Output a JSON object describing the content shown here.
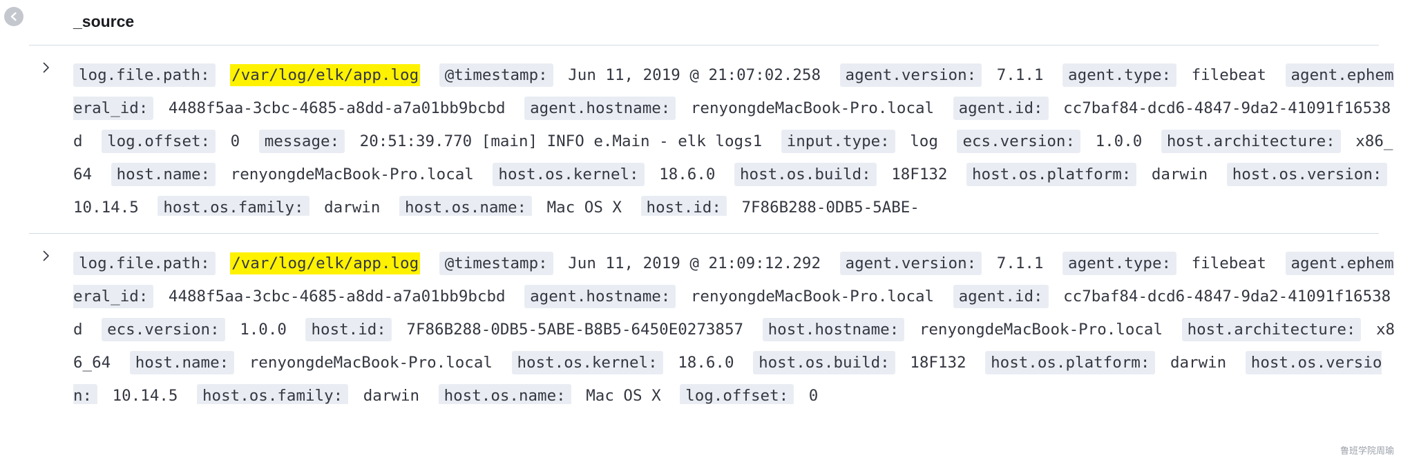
{
  "header": {
    "title": "_source"
  },
  "icons": {
    "back": "chevron-left-circle-icon",
    "expand": "chevron-right-icon"
  },
  "rows": [
    {
      "fields": [
        {
          "key": "log.file.path:",
          "value": "/var/log/elk/app.log",
          "highlight": true
        },
        {
          "key": "@timestamp:",
          "value": "Jun 11, 2019 @ 21:07:02.258"
        },
        {
          "key": "agent.version:",
          "value": "7.1.1"
        },
        {
          "key": "agent.type:",
          "value": "filebeat"
        },
        {
          "key": "agent.ephemeral_id:",
          "value": "4488f5aa-3cbc-4685-a8dd-a7a01bb9bcbd"
        },
        {
          "key": "agent.hostname:",
          "value": "renyongdeMacBook-Pro.local"
        },
        {
          "key": "agent.id:",
          "value": "cc7baf84-dcd6-4847-9da2-41091f16538d"
        },
        {
          "key": "log.offset:",
          "value": "0"
        },
        {
          "key": "message:",
          "value": "20:51:39.770 [main] INFO e.Main - elk logs1"
        },
        {
          "key": "input.type:",
          "value": "log"
        },
        {
          "key": "ecs.version:",
          "value": "1.0.0"
        },
        {
          "key": "host.architecture:",
          "value": "x86_64"
        },
        {
          "key": "host.name:",
          "value": "renyongdeMacBook-Pro.local"
        },
        {
          "key": "host.os.kernel:",
          "value": "18.6.0"
        },
        {
          "key": "host.os.build:",
          "value": "18F132"
        },
        {
          "key": "host.os.platform:",
          "value": "darwin"
        },
        {
          "key": "host.os.version:",
          "value": "10.14.5"
        },
        {
          "key": "host.os.family:",
          "value": "darwin"
        },
        {
          "key": "host.os.name:",
          "value": "Mac OS X"
        },
        {
          "key": "host.id:",
          "value": "7F86B288-0DB5-5ABE-"
        }
      ]
    },
    {
      "fields": [
        {
          "key": "log.file.path:",
          "value": "/var/log/elk/app.log",
          "highlight": true
        },
        {
          "key": "@timestamp:",
          "value": "Jun 11, 2019 @ 21:09:12.292"
        },
        {
          "key": "agent.version:",
          "value": "7.1.1"
        },
        {
          "key": "agent.type:",
          "value": "filebeat"
        },
        {
          "key": "agent.ephemeral_id:",
          "value": "4488f5aa-3cbc-4685-a8dd-a7a01bb9bcbd"
        },
        {
          "key": "agent.hostname:",
          "value": "renyongdeMacBook-Pro.local"
        },
        {
          "key": "agent.id:",
          "value": "cc7baf84-dcd6-4847-9da2-41091f16538d"
        },
        {
          "key": "ecs.version:",
          "value": "1.0.0"
        },
        {
          "key": "host.id:",
          "value": "7F86B288-0DB5-5ABE-B8B5-6450E0273857"
        },
        {
          "key": "host.hostname:",
          "value": "renyongdeMacBook-Pro.local"
        },
        {
          "key": "host.architecture:",
          "value": "x86_64"
        },
        {
          "key": "host.name:",
          "value": "renyongdeMacBook-Pro.local"
        },
        {
          "key": "host.os.kernel:",
          "value": "18.6.0"
        },
        {
          "key": "host.os.build:",
          "value": "18F132"
        },
        {
          "key": "host.os.platform:",
          "value": "darwin"
        },
        {
          "key": "host.os.version:",
          "value": "10.14.5"
        },
        {
          "key": "host.os.family:",
          "value": "darwin"
        },
        {
          "key": "host.os.name:",
          "value": "Mac OS X"
        },
        {
          "key": "log.offset:",
          "value": "0"
        }
      ]
    }
  ],
  "colors": {
    "key_bg": "#e9edf3",
    "highlight": "#fff200",
    "divider": "#d3dae6",
    "text": "#343741"
  },
  "watermark": "鲁班学院周瑜"
}
